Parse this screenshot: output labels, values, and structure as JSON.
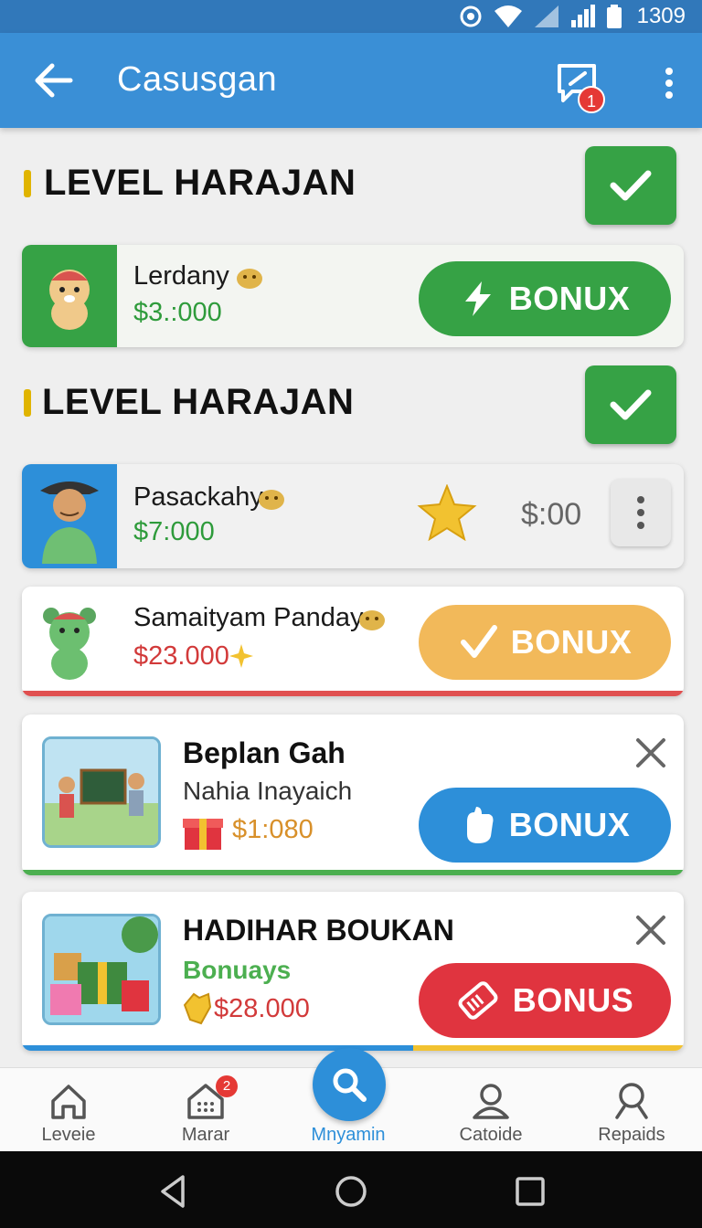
{
  "status_bar": {
    "time": "1309"
  },
  "app_bar": {
    "title": "Casusgan",
    "message_badge": "1"
  },
  "sections": [
    {
      "label": "LEVEL HARAJAN"
    },
    {
      "label": "LEVEL HARAJAN"
    }
  ],
  "cards": [
    {
      "name": "Lerdany",
      "amount": "$3.:000",
      "button_label": "BONUX",
      "button_color": "#36a245",
      "avatar_bg": "#36a245"
    },
    {
      "name": "Pasackahy",
      "amount": "$7:000",
      "side_value": "$:00",
      "avatar_bg": "#2d8fd9"
    },
    {
      "name": "Samaityam Panday",
      "amount": "$23.000",
      "button_label": "BONUX",
      "button_color": "#f2b95a",
      "line_color": "#e05050"
    },
    {
      "title": "Beplan Gah",
      "subtitle": "Nahia Inayaich",
      "amount": "$1:080",
      "button_label": "BONUX",
      "button_color": "#2d8fd9"
    },
    {
      "title": "HADIHAR BOUKAN",
      "subtitle": "Bonuays",
      "amount": "$28.000",
      "button_label": "BONUS",
      "button_color": "#e0343f"
    }
  ],
  "bottom_nav": {
    "items": [
      {
        "label": "Leveie"
      },
      {
        "label": "Marar",
        "badge": "2"
      },
      {
        "label": "Mnyamin"
      },
      {
        "label": "Catoide"
      },
      {
        "label": "Repaids"
      }
    ]
  },
  "colors": {
    "primary": "#3a8fd6",
    "green": "#36a245",
    "red": "#e0343f",
    "orange": "#f2b95a",
    "amount_green": "#2e9b3b",
    "amount_red": "#d23a3a",
    "amount_orange": "#d8902a"
  }
}
